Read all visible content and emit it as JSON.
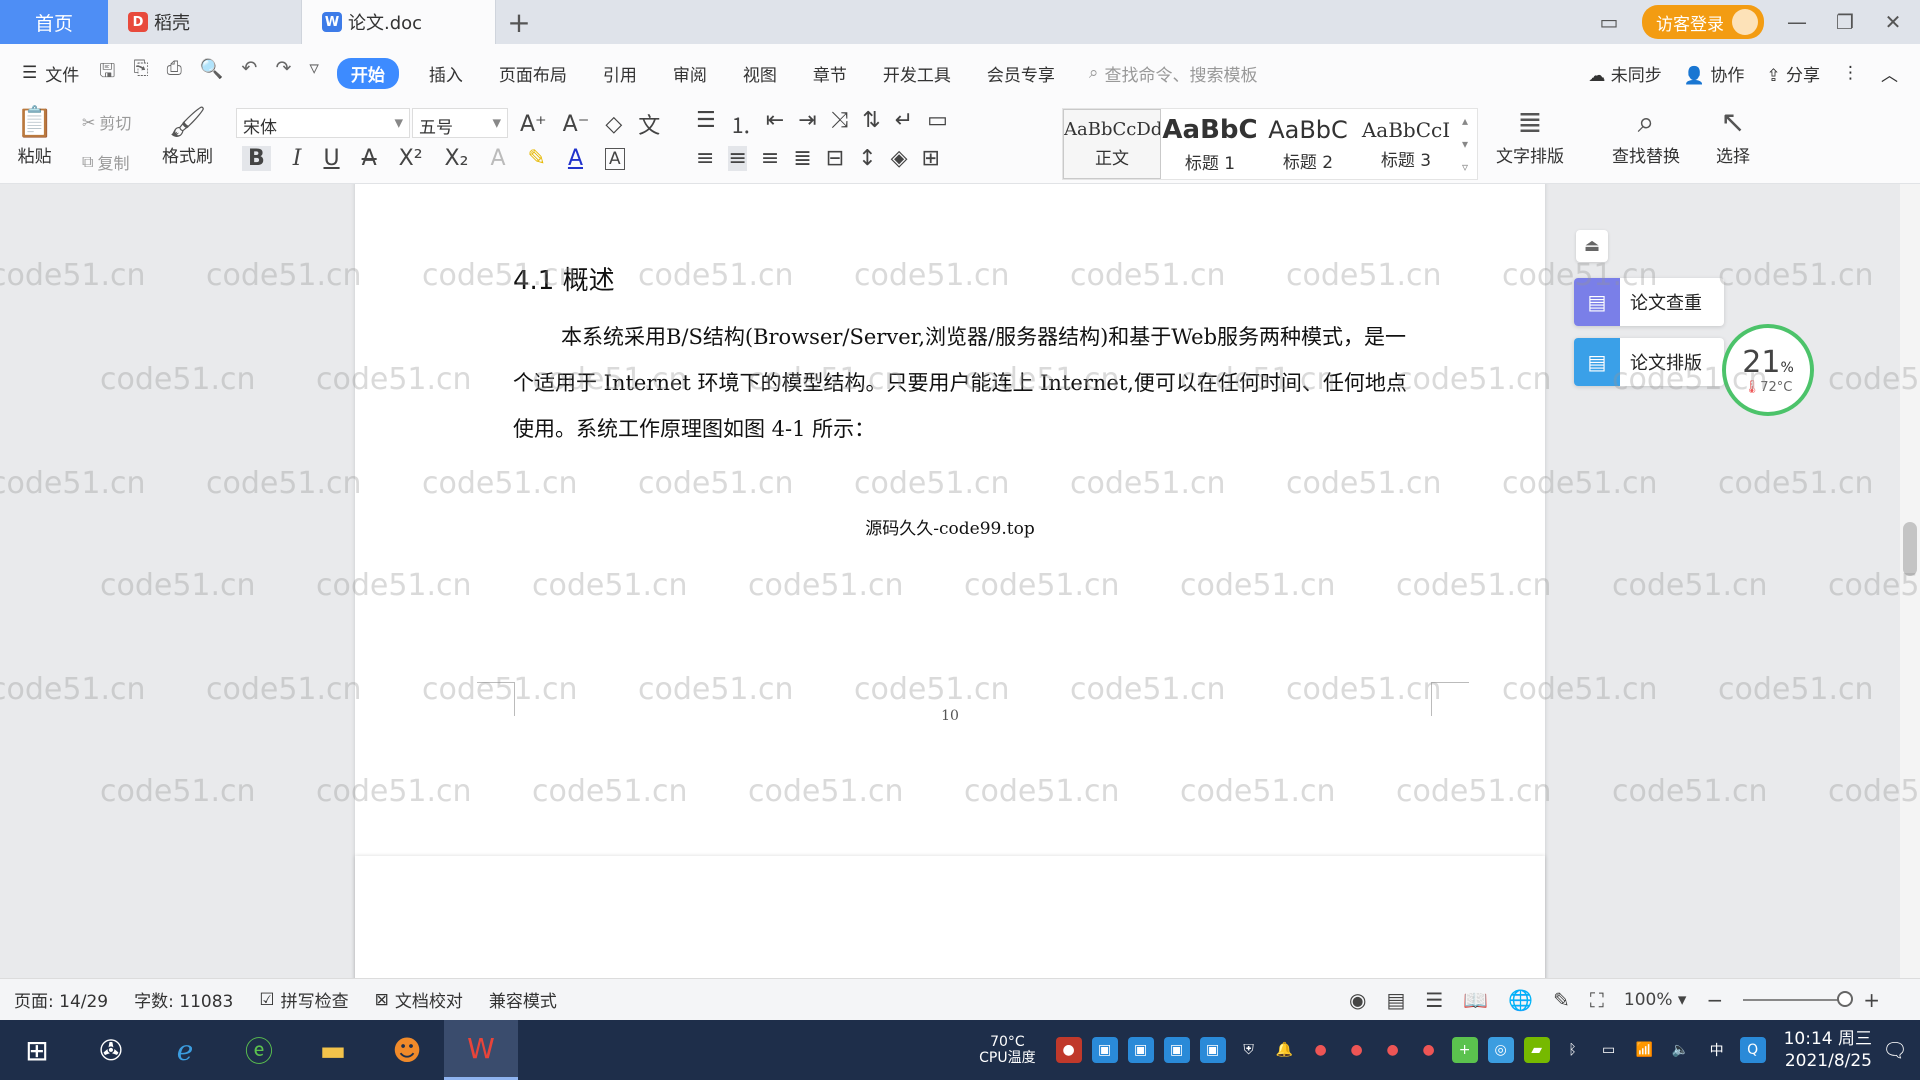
{
  "titlebar": {
    "home_tab": "首页",
    "tab_daoke": "稻壳",
    "tab_doc": "论文.doc",
    "add_tab": "+",
    "visitor_login": "访客登录",
    "win_minimize": "—",
    "win_restore": "❐",
    "win_close": "✕"
  },
  "menubar": {
    "file": "文件",
    "items": [
      "开始",
      "插入",
      "页面布局",
      "引用",
      "审阅",
      "视图",
      "章节",
      "开发工具",
      "会员专享"
    ],
    "search_placeholder": "查找命令、搜索模板",
    "unsynced": "未同步",
    "collaborate": "协作",
    "share": "分享"
  },
  "ribbon": {
    "paste": "粘贴",
    "cut": "剪切",
    "copy": "复制",
    "format_painter": "格式刷",
    "font_name": "宋体",
    "font_size": "五号",
    "styles": [
      {
        "sample": "AaBbCcDd",
        "label": "正文"
      },
      {
        "sample": "AaBbC",
        "label": "标题 1"
      },
      {
        "sample": "AaBbC",
        "label": "标题 2"
      },
      {
        "sample": "AaBbCcI",
        "label": "标题 3"
      }
    ],
    "text_layout": "文字排版",
    "find_replace": "查找替换",
    "select": "选择"
  },
  "document": {
    "heading": "4.1 概述",
    "paragraph": "本系统采用B/S结构(Browser/Server,浏览器/服务器结构)和基于Web服务两种模式，是一个适用于 Internet 环境下的模型结构。只要用户能连上 Internet,便可以在任何时间、任何地点使用。系统工作原理图如图 4-1 所示：",
    "caption": "源码久久-code99.top",
    "page_number": "10",
    "watermark": "code51.cn"
  },
  "sidepanel": {
    "paper_check": "论文查重",
    "paper_layout": "论文排版",
    "cpu_percent": "21",
    "cpu_percent_unit": "%",
    "cpu_temp": "72°C"
  },
  "statusbar": {
    "page": "页面: 14/29",
    "words": "字数: 11083",
    "spell_check": "拼写检查",
    "doc_proof": "文档校对",
    "compat_mode": "兼容模式",
    "zoom": "100%"
  },
  "taskbar": {
    "cpu_temp_value": "70°C",
    "cpu_temp_label": "CPU温度",
    "ime": "中",
    "time": "10:14 周三",
    "date": "2021/8/25"
  },
  "colors": {
    "accent": "#3d8bff",
    "home_tab": "#4e8ef5",
    "visitor": "#f39c12",
    "taskbar": "#1e2e4a",
    "cpu_ring": "#4cc36a"
  }
}
